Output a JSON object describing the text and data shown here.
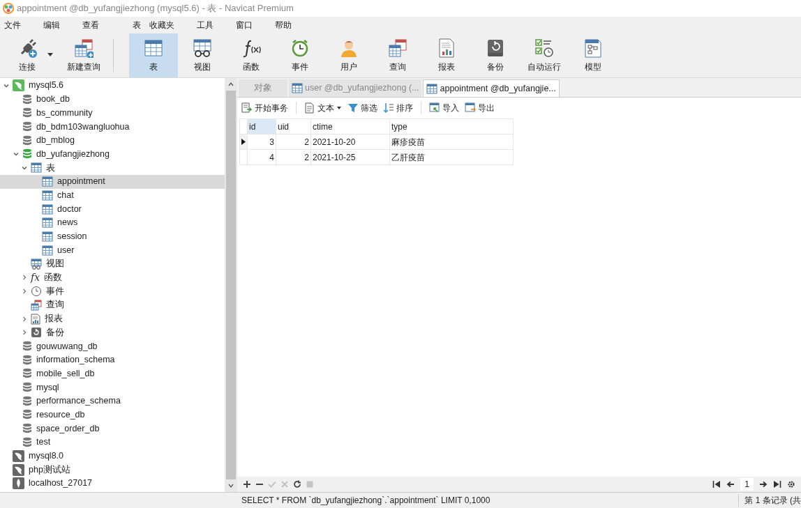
{
  "window": {
    "title": "appointment @db_yufangjiezhong (mysql5.6) - 表 - Navicat Premium"
  },
  "menu": [
    "文件",
    "编辑",
    "查看",
    "表",
    "收藏夹",
    "工具",
    "窗口",
    "帮助"
  ],
  "toolbar": [
    {
      "label": "连接",
      "kind": "connect",
      "selected": false,
      "dropdown": true
    },
    {
      "label": "新建查询",
      "kind": "new-query",
      "selected": false
    },
    {
      "label": "表",
      "kind": "table",
      "selected": true
    },
    {
      "label": "视图",
      "kind": "view",
      "selected": false
    },
    {
      "label": "函数",
      "kind": "function",
      "selected": false
    },
    {
      "label": "事件",
      "kind": "event",
      "selected": false
    },
    {
      "label": "用户",
      "kind": "user",
      "selected": false
    },
    {
      "label": "查询",
      "kind": "query",
      "selected": false
    },
    {
      "label": "报表",
      "kind": "report",
      "selected": false
    },
    {
      "label": "备份",
      "kind": "backup",
      "selected": false
    },
    {
      "label": "自动运行",
      "kind": "schedule",
      "selected": false
    },
    {
      "label": "模型",
      "kind": "model",
      "selected": false
    }
  ],
  "tree": [
    {
      "label": "mysql5.6",
      "kind": "connection",
      "open": true,
      "expanded": true,
      "children": [
        {
          "label": "book_db",
          "kind": "database",
          "open": false
        },
        {
          "label": "bs_community",
          "kind": "database",
          "open": false
        },
        {
          "label": "db_bdm103wangluohua",
          "kind": "database",
          "open": false
        },
        {
          "label": "db_mblog",
          "kind": "database",
          "open": false
        },
        {
          "label": "db_yufangjiezhong",
          "kind": "database",
          "open": true,
          "expanded": true,
          "children": [
            {
              "label": "表",
              "kind": "tables",
              "expanded": true,
              "children": [
                {
                  "label": "appointment",
                  "kind": "table",
                  "selected": true
                },
                {
                  "label": "chat",
                  "kind": "table",
                  "selected": false
                },
                {
                  "label": "doctor",
                  "kind": "table",
                  "selected": false
                },
                {
                  "label": "news",
                  "kind": "table",
                  "selected": false
                },
                {
                  "label": "session",
                  "kind": "table",
                  "selected": false
                },
                {
                  "label": "user",
                  "kind": "table",
                  "selected": false
                }
              ]
            },
            {
              "label": "视图",
              "kind": "views"
            },
            {
              "label": "函数",
              "kind": "functions",
              "icon": "fx",
              "expanded": false
            },
            {
              "label": "事件",
              "kind": "events",
              "expanded": false
            },
            {
              "label": "查询",
              "kind": "queries"
            },
            {
              "label": "报表",
              "kind": "reports",
              "expanded": false
            },
            {
              "label": "备份",
              "kind": "backups",
              "expanded": false
            }
          ]
        },
        {
          "label": "gouwuwang_db",
          "kind": "database",
          "open": false
        },
        {
          "label": "information_schema",
          "kind": "database",
          "open": false
        },
        {
          "label": "mobile_sell_db",
          "kind": "database",
          "open": false
        },
        {
          "label": "mysql",
          "kind": "database",
          "open": false
        },
        {
          "label": "performance_schema",
          "kind": "database",
          "open": false
        },
        {
          "label": "resource_db",
          "kind": "database",
          "open": false
        },
        {
          "label": "space_order_db",
          "kind": "database",
          "open": false
        },
        {
          "label": "test",
          "kind": "database",
          "open": false
        }
      ]
    },
    {
      "label": "mysql8.0",
      "kind": "connection",
      "open": false
    },
    {
      "label": "php测试站",
      "kind": "connection",
      "open": false
    },
    {
      "label": "localhost_27017",
      "kind": "mongo"
    }
  ],
  "tabs": [
    {
      "label": "对象",
      "kind": "objects",
      "selected": false
    },
    {
      "label": "user @db_yufangjiezhong (...",
      "kind": "table",
      "selected": false
    },
    {
      "label": "appointment @db_yufangjie...",
      "kind": "table",
      "selected": true
    }
  ],
  "actions": [
    {
      "label": "开始事务",
      "kind": "transaction"
    },
    {
      "label": "文本",
      "kind": "text",
      "dropdown": true
    },
    {
      "label": "筛选",
      "kind": "filter"
    },
    {
      "label": "排序",
      "kind": "sort"
    },
    {
      "label": "导入",
      "kind": "import"
    },
    {
      "label": "导出",
      "kind": "export"
    }
  ],
  "grid": {
    "columns": [
      {
        "label": "id",
        "selected": true
      },
      {
        "label": "uid",
        "selected": false
      },
      {
        "label": "ctime",
        "selected": false
      },
      {
        "label": "type",
        "selected": false
      }
    ],
    "rows": [
      {
        "current": true,
        "cells": [
          "3",
          "2",
          "2021-10-20",
          "麻疹疫苗"
        ]
      },
      {
        "current": false,
        "cells": [
          "4",
          "2",
          "2021-10-25",
          "乙肝疫苗"
        ]
      }
    ]
  },
  "record_buttons": [
    {
      "kind": "add",
      "disabled": false
    },
    {
      "kind": "delete",
      "disabled": false
    },
    {
      "kind": "apply",
      "disabled": true
    },
    {
      "kind": "cancel",
      "disabled": true
    },
    {
      "kind": "refresh",
      "disabled": false
    },
    {
      "kind": "stop",
      "disabled": true
    }
  ],
  "pager": {
    "page": "1"
  },
  "status_bar": {
    "sql": "SELECT * FROM `db_yufangjiezhong`.`appointment` LIMIT 0,1000",
    "records": "第 1 条记录 (共"
  }
}
